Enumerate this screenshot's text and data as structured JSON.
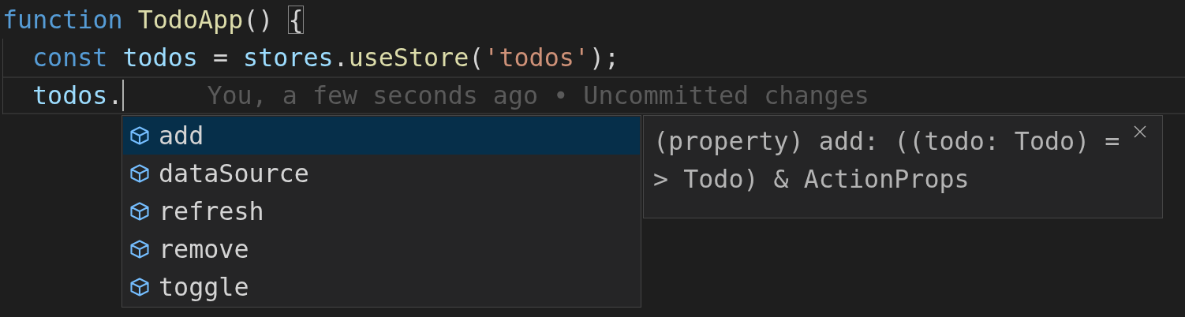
{
  "editor": {
    "lines": [
      {
        "tokens": [
          {
            "text": "function ",
            "kind": "keyword"
          },
          {
            "text": "TodoApp",
            "kind": "function"
          },
          {
            "text": "() ",
            "kind": "punct"
          },
          {
            "text": "{",
            "kind": "punct",
            "matched": true
          }
        ],
        "children": [
          {
            "tokens": [
              {
                "text": "const ",
                "kind": "keyword"
              },
              {
                "text": "todos ",
                "kind": "variable"
              },
              {
                "text": "= ",
                "kind": "punct"
              },
              {
                "text": "stores",
                "kind": "variable"
              },
              {
                "text": ".",
                "kind": "punct"
              },
              {
                "text": "useStore",
                "kind": "function"
              },
              {
                "text": "(",
                "kind": "punct"
              },
              {
                "text": "'todos'",
                "kind": "string"
              },
              {
                "text": ");",
                "kind": "punct"
              }
            ]
          },
          {
            "tokens": [
              {
                "text": "todos",
                "kind": "variable"
              },
              {
                "text": ".",
                "kind": "punct"
              }
            ],
            "current": true,
            "cursor": true,
            "blame": "You, a few seconds ago • Uncommitted changes"
          }
        ]
      }
    ]
  },
  "suggestions": {
    "items": [
      {
        "label": "add",
        "kind": "property",
        "selected": true
      },
      {
        "label": "dataSource",
        "kind": "property",
        "selected": false
      },
      {
        "label": "refresh",
        "kind": "property",
        "selected": false
      },
      {
        "label": "remove",
        "kind": "property",
        "selected": false
      },
      {
        "label": "toggle",
        "kind": "property",
        "selected": false
      }
    ],
    "details": {
      "text": "(property) add: ((todo: Todo) => Todo) & ActionProps"
    }
  }
}
